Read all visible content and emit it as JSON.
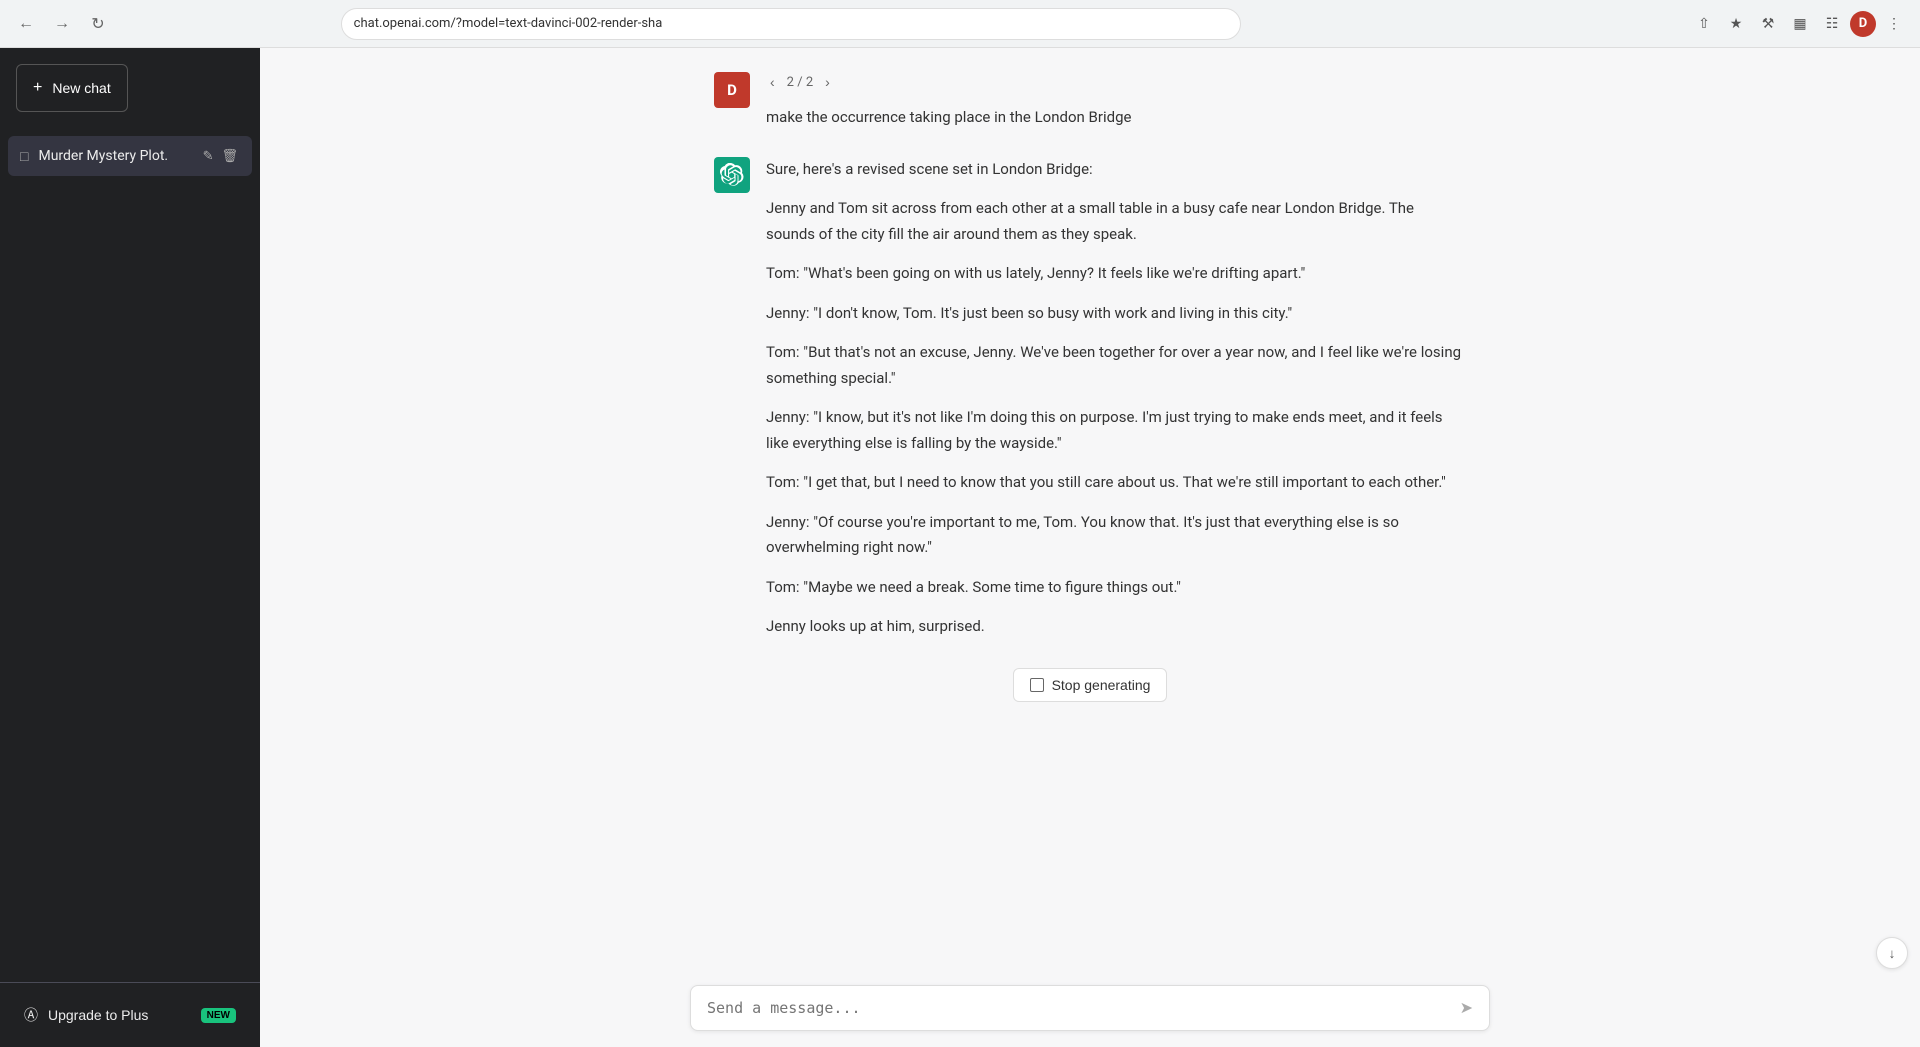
{
  "browser": {
    "url": "chat.openai.com/?model=text-davinci-002-render-sha",
    "avatar_letter": "D"
  },
  "sidebar": {
    "new_chat_label": "New chat",
    "conversations": [
      {
        "id": "murder-mystery",
        "label": "Murder Mystery Plot."
      }
    ],
    "upgrade_label": "Upgrade to Plus",
    "new_badge": "NEW"
  },
  "chat": {
    "nav": {
      "current": "2",
      "total": "2"
    },
    "user_message": {
      "avatar_letter": "D",
      "text": "make the occurrence taking place in the London Bridge"
    },
    "ai_response": {
      "intro": "Sure, here's a revised scene set in London Bridge:",
      "paragraphs": [
        "Jenny and Tom sit across from each other at a small table in a busy cafe near London Bridge. The sounds of the city fill the air around them as they speak.",
        "Tom: \"What's been going on with us lately, Jenny? It feels like we're drifting apart.\"",
        "Jenny: \"I don't know, Tom. It's just been so busy with work and living in this city.\"",
        "Tom: \"But that's not an excuse, Jenny. We've been together for over a year now, and I feel like we're losing something special.\"",
        "Jenny: \"I know, but it's not like I'm doing this on purpose. I'm just trying to make ends meet, and it feels like everything else is falling by the wayside.\"",
        "Tom: \"I get that, but I need to know that you still care about us. That we're still important to each other.\"",
        "Jenny: \"Of course you're important to me, Tom. You know that. It's just that everything else is so overwhelming right now.\"",
        "Tom: \"Maybe we need a break. Some time to figure things out.\"",
        "Jenny looks up at him, surprised."
      ]
    },
    "stop_btn_label": "Stop generating",
    "input_placeholder": "Send a message..."
  }
}
